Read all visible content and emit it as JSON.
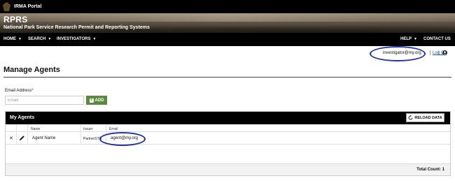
{
  "topbar": {
    "portal_label": "IRMA Portal",
    "logo_icon": "arrowhead-icon"
  },
  "banner": {
    "title": "RPRS",
    "subtitle": "National Park Service Research Permit and Reporting Systems"
  },
  "nav": {
    "items": [
      {
        "label": "HOME",
        "caret": "▼"
      },
      {
        "label": "SEARCH",
        "caret": "▼"
      },
      {
        "label": "INVESTIGATORS",
        "caret": "▼"
      }
    ],
    "help_label": "HELP",
    "help_caret": "▼",
    "contact_label": "CONTACT US"
  },
  "user": {
    "email": "investigator@my.org",
    "logoff": "Log Off",
    "left_bracket": "[",
    "right_bracket": "]",
    "icon": "user-circle-icon"
  },
  "page": {
    "title": "Manage Agents"
  },
  "form": {
    "email_label": "Email Address",
    "required_mark": "*",
    "email_placeholder": "Email",
    "email_value": "",
    "add_label": "ADD",
    "add_icon": "plus-icon"
  },
  "agents": {
    "title": "My Agents",
    "reload_label": "RELOAD DATA",
    "reload_icon": "refresh-icon",
    "columns": [
      "Name",
      "Issuer",
      "Email"
    ],
    "rows": [
      {
        "remove_icon": "close-icon",
        "remove_glyph": "✕",
        "edit_icon": "pencil-icon",
        "name": "Agent Name",
        "issuer": "PartnerSTS",
        "email": "agent@my.org"
      }
    ],
    "total_label": "Total Count: 1"
  },
  "colors": {
    "header_bg": "#000000",
    "add_button": "#5c8a3c",
    "annotation_ellipse": "#2332a8",
    "required": "#cc0000",
    "link": "#1a4fb5"
  }
}
